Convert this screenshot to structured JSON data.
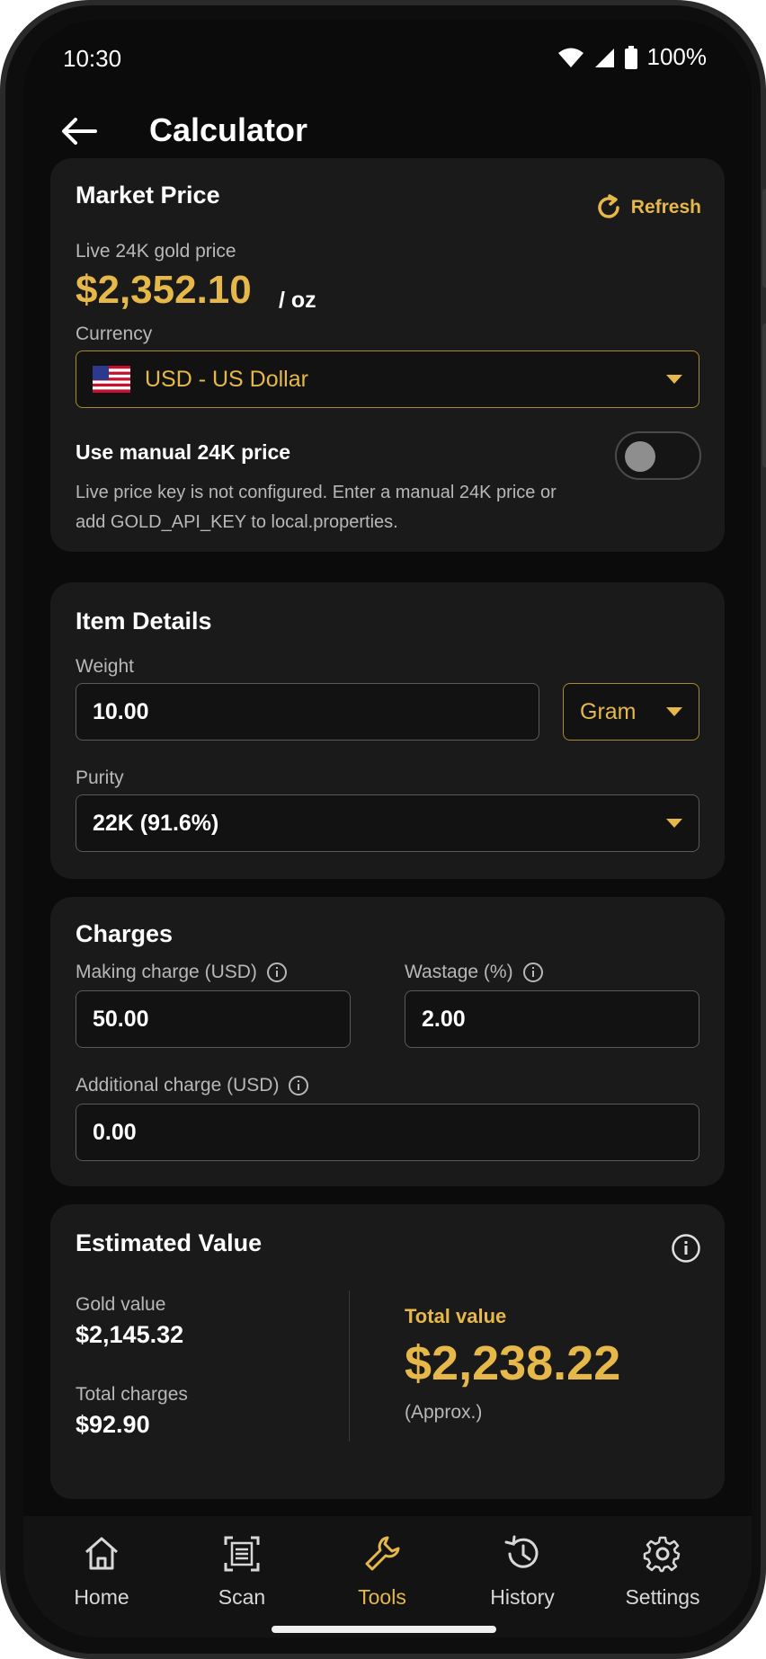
{
  "status": {
    "time": "10:30",
    "battery": "100%"
  },
  "appbar": {
    "title": "Calculator"
  },
  "market": {
    "title": "Market Price",
    "refresh_label": "Refresh",
    "subtitle": "Live 24K gold price",
    "price": "$2,352.10",
    "unit": "/ oz",
    "currency_label": "Currency",
    "currency_value": "USD - US Dollar",
    "manual_label": "Use manual 24K price",
    "manual_enabled": false,
    "note": "Live price key is not configured. Enter a manual 24K price or add GOLD_API_KEY to local.properties."
  },
  "item": {
    "title": "Item Details",
    "weight_label": "Weight",
    "weight_value": "10.00",
    "weight_unit": "Gram",
    "purity_label": "Purity",
    "purity_value": "22K (91.6%)"
  },
  "charges": {
    "title": "Charges",
    "making_label": "Making charge (USD)",
    "making_value": "50.00",
    "wastage_label": "Wastage (%)",
    "wastage_value": "2.00",
    "additional_label": "Additional charge (USD)",
    "additional_value": "0.00"
  },
  "estimate": {
    "title": "Estimated Value",
    "gold_label": "Gold value",
    "gold_value": "$2,145.32",
    "charges_label": "Total charges",
    "charges_value": "$92.90",
    "total_label": "Total value",
    "total_value": "$2,238.22",
    "approx": "(Approx.)"
  },
  "nav": {
    "items": [
      {
        "label": "Home",
        "icon": "home-icon"
      },
      {
        "label": "Scan",
        "icon": "scan-icon"
      },
      {
        "label": "Tools",
        "icon": "wrench-icon",
        "active": true
      },
      {
        "label": "History",
        "icon": "history-icon"
      },
      {
        "label": "Settings",
        "icon": "gear-icon"
      }
    ]
  },
  "colors": {
    "accent": "#e6b84a",
    "background": "#0b0b0b",
    "card": "#1a1a1a"
  }
}
